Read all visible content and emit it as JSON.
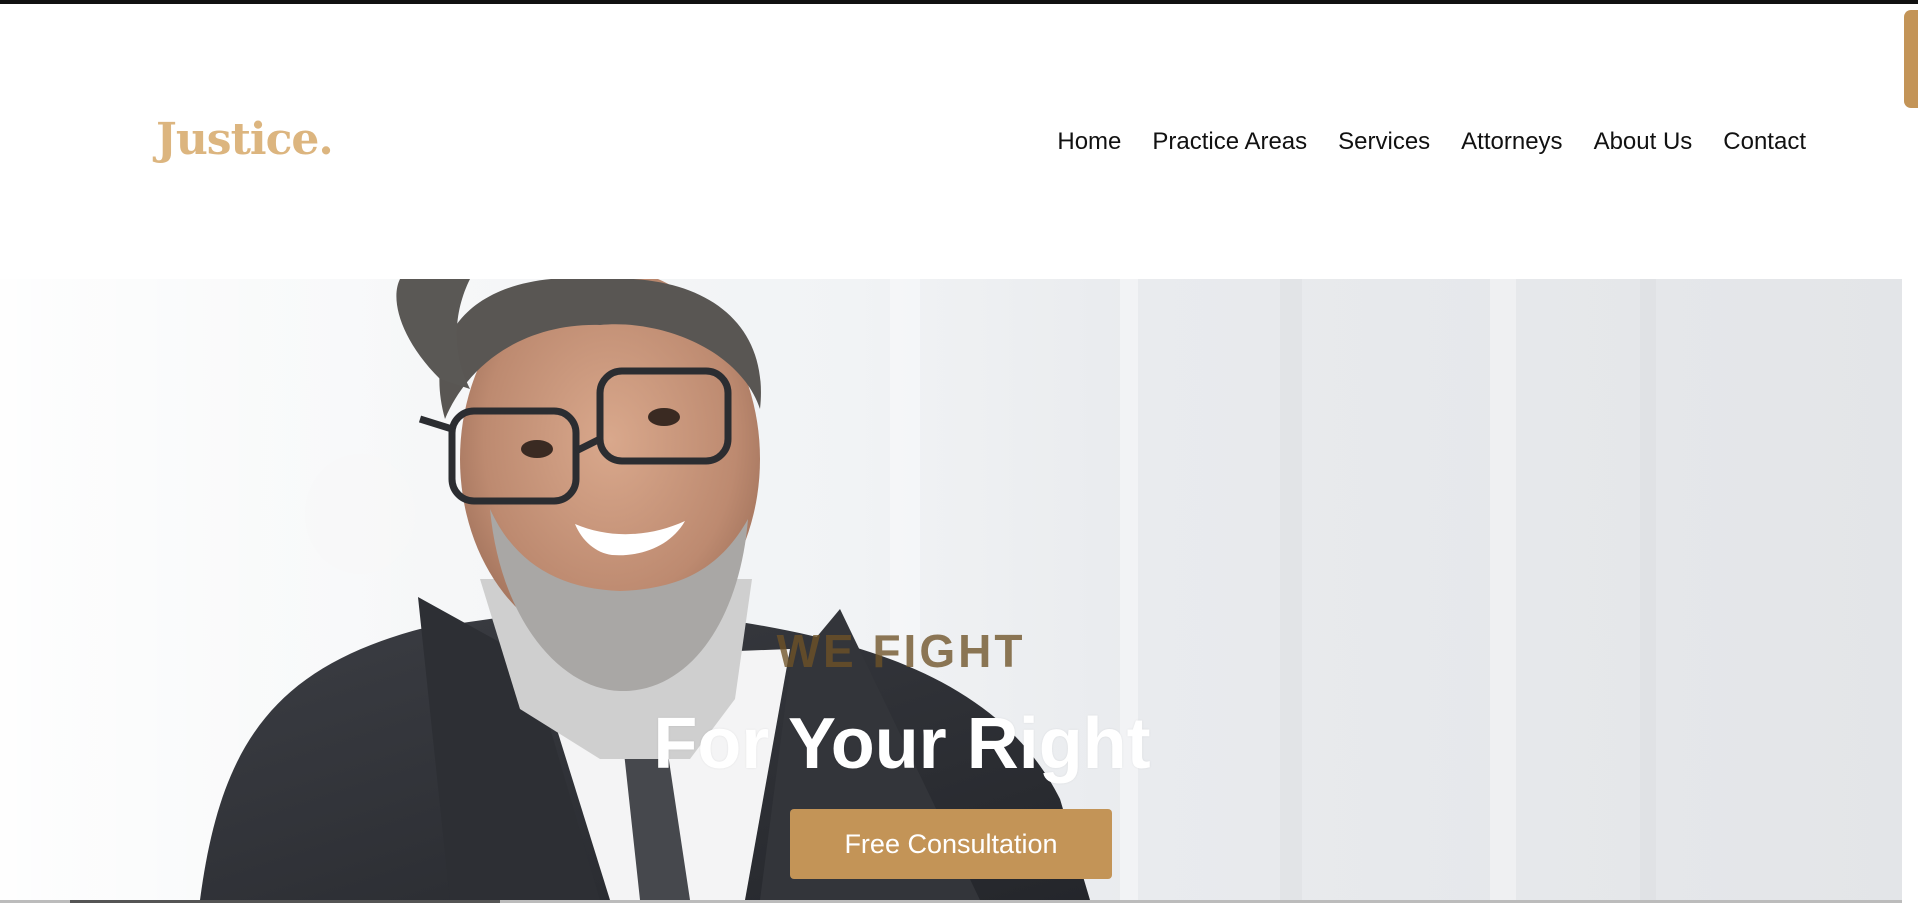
{
  "brand": {
    "logo_text": "Justice.",
    "accent_color": "#c39457",
    "logo_color": "#dcb57f"
  },
  "nav": {
    "items": [
      {
        "label": "Home"
      },
      {
        "label": "Practice Areas"
      },
      {
        "label": "Services"
      },
      {
        "label": "Attorneys"
      },
      {
        "label": "About Us"
      },
      {
        "label": "Contact"
      }
    ]
  },
  "hero": {
    "kicker": "WE FIGHT",
    "headline": "For Your Right",
    "cta_label": "Free Consultation",
    "image_alt": "Smiling bearded man with glasses in dark suit and tie"
  }
}
